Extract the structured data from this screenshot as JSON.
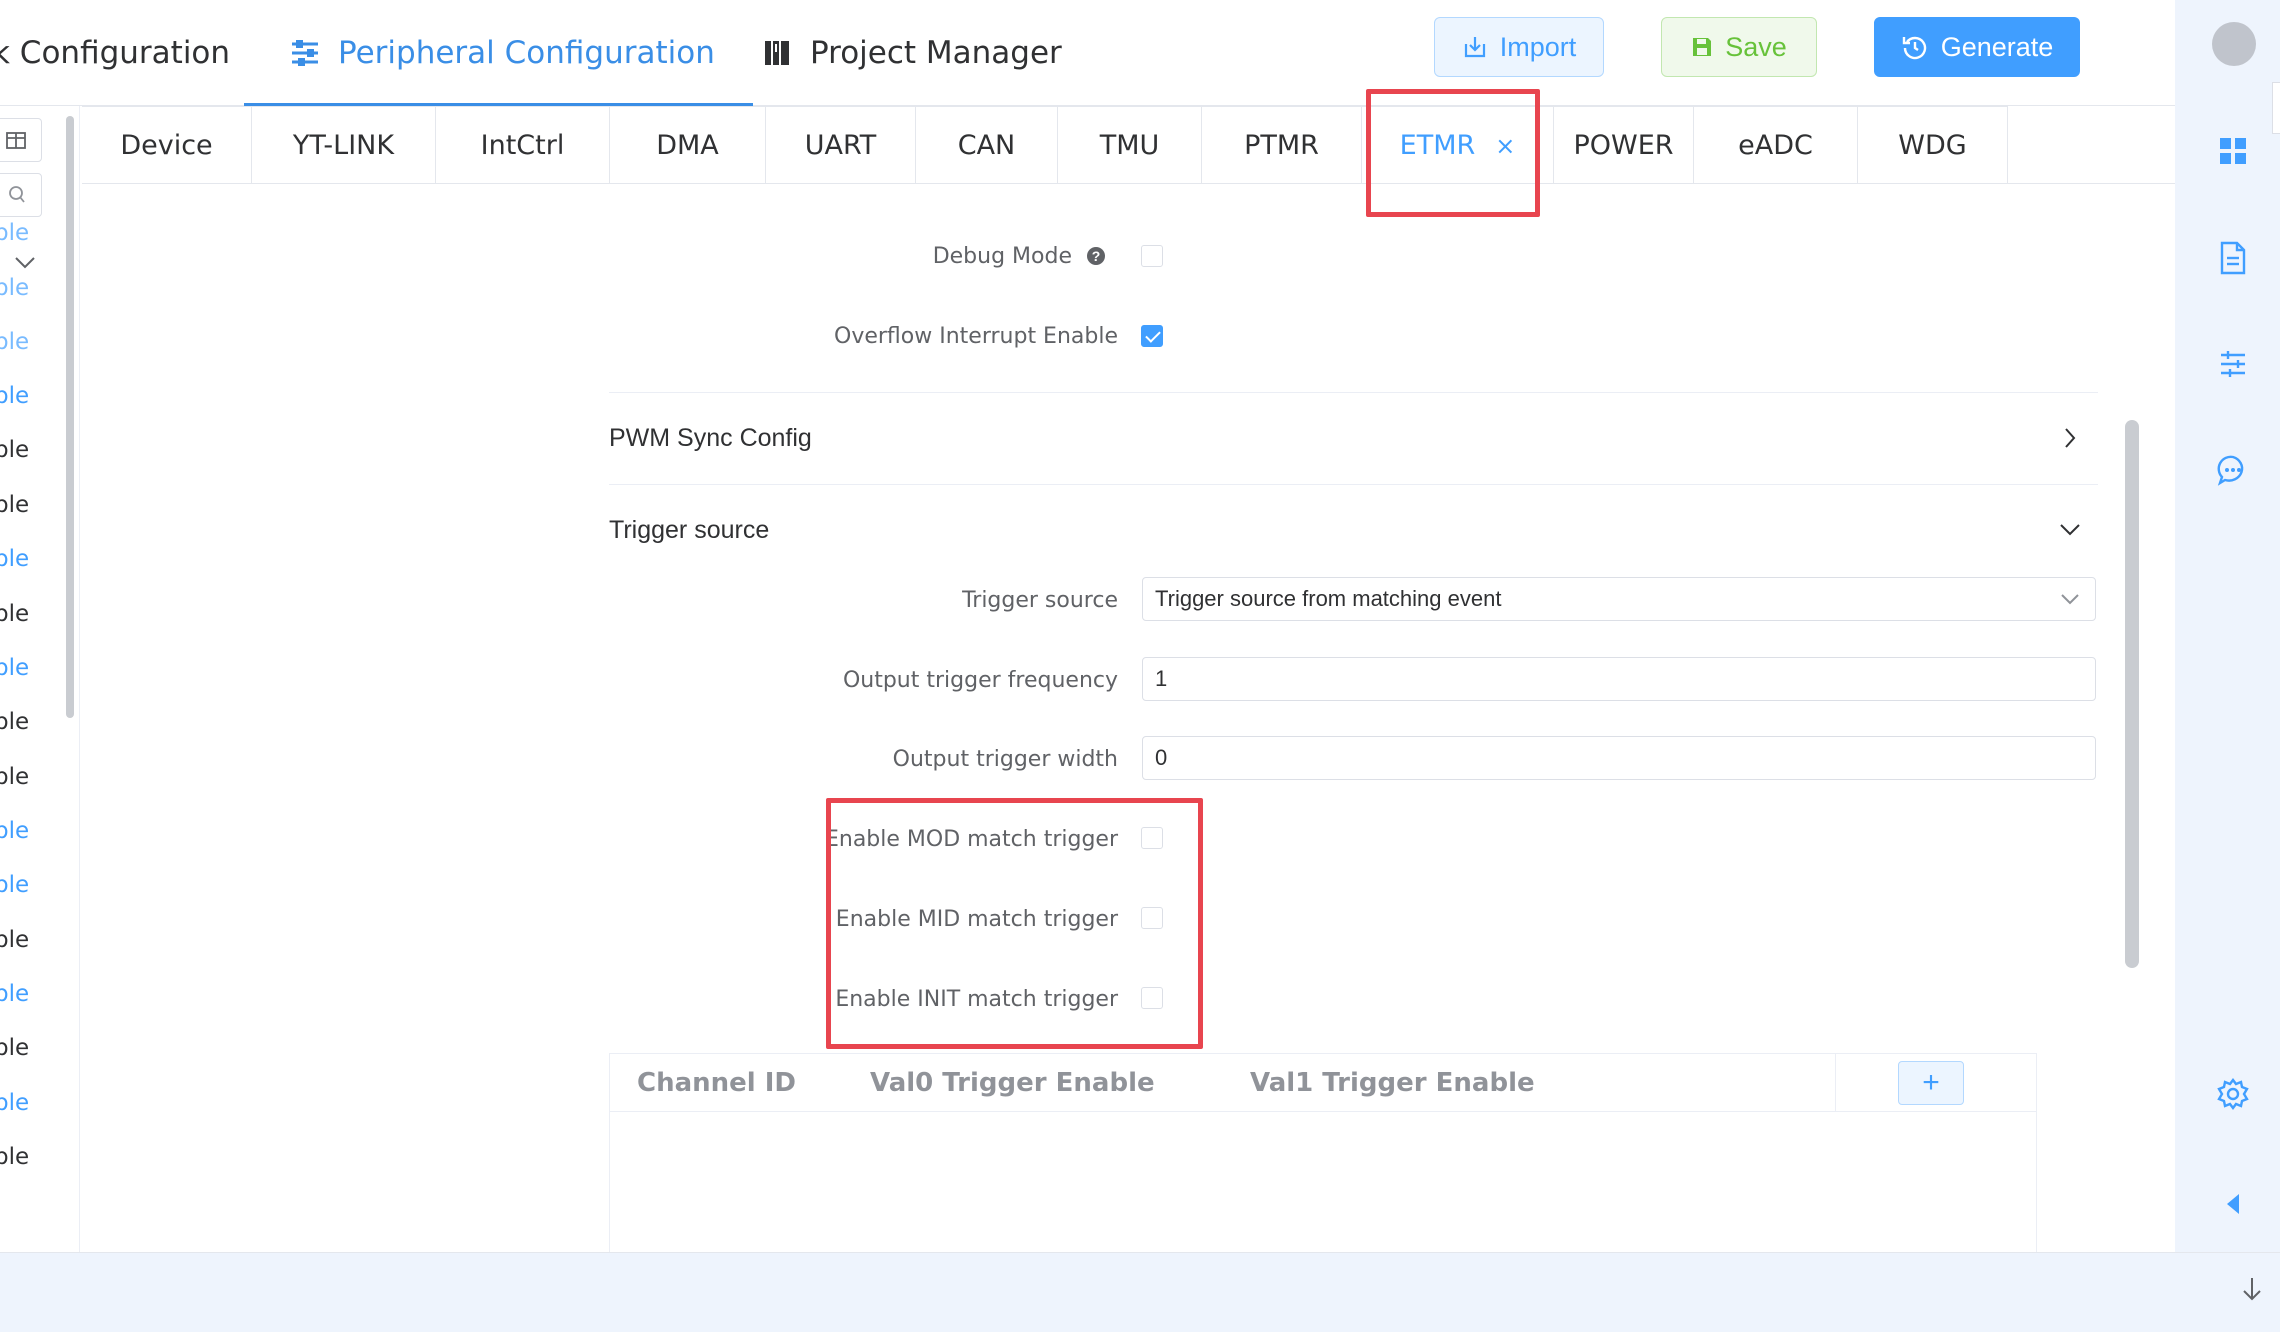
{
  "header": {
    "tabs": [
      {
        "label": "k Configuration",
        "icon": "cpu-icon"
      },
      {
        "label": "Peripheral Configuration",
        "icon": "peripheral-icon",
        "active": true
      },
      {
        "label": "Project Manager",
        "icon": "project-icon"
      }
    ],
    "buttons": {
      "import": "Import",
      "save": "Save",
      "generate": "Generate"
    }
  },
  "sidebar": {
    "items": [
      {
        "label": "ble",
        "color": "lightblue"
      },
      {
        "label": "ble",
        "color": "lightblue"
      },
      {
        "label": "ble",
        "color": "lightblue"
      },
      {
        "label": "ble",
        "color": "blue"
      },
      {
        "label": "ble",
        "color": "dark"
      },
      {
        "label": "ble",
        "color": "dark"
      },
      {
        "label": "ble",
        "color": "blue"
      },
      {
        "label": "ble",
        "color": "dark"
      },
      {
        "label": "ble",
        "color": "blue"
      },
      {
        "label": "ble",
        "color": "dark"
      },
      {
        "label": "ble",
        "color": "dark"
      },
      {
        "label": "ble",
        "color": "blue"
      },
      {
        "label": "ble",
        "color": "blue"
      },
      {
        "label": "ble",
        "color": "dark"
      },
      {
        "label": "ble",
        "color": "blue"
      },
      {
        "label": "ble",
        "color": "dark"
      },
      {
        "label": "ble",
        "color": "blue"
      },
      {
        "label": "ble",
        "color": "dark"
      }
    ]
  },
  "subtabs": [
    "Device",
    "YT-LINK",
    "IntCtrl",
    "DMA",
    "UART",
    "CAN",
    "TMU",
    "PTMR",
    "ETMR",
    "POWER",
    "eADC",
    "WDG"
  ],
  "active_subtab": "ETMR",
  "form": {
    "debug_mode_label": "Debug Mode",
    "debug_mode_checked": false,
    "overflow_label": "Overflow Interrupt Enable",
    "overflow_checked": true,
    "pwm_sync_title": "PWM Sync Config",
    "trigger_section_title": "Trigger source",
    "trigger_source_label": "Trigger source",
    "trigger_source_value": "Trigger source from matching event",
    "output_freq_label": "Output trigger frequency",
    "output_freq_value": "1",
    "output_width_label": "Output trigger width",
    "output_width_value": "0",
    "mod_match_label": "Enable MOD match trigger",
    "mid_match_label": "Enable MID match trigger",
    "init_match_label": "Enable INIT match trigger"
  },
  "table": {
    "columns": [
      "Channel ID",
      "Val0 Trigger Enable",
      "Val1 Trigger Enable"
    ],
    "add_label": "+"
  },
  "colors": {
    "accent": "#409eff",
    "highlight": "#e8454f",
    "success": "#67c23a"
  }
}
